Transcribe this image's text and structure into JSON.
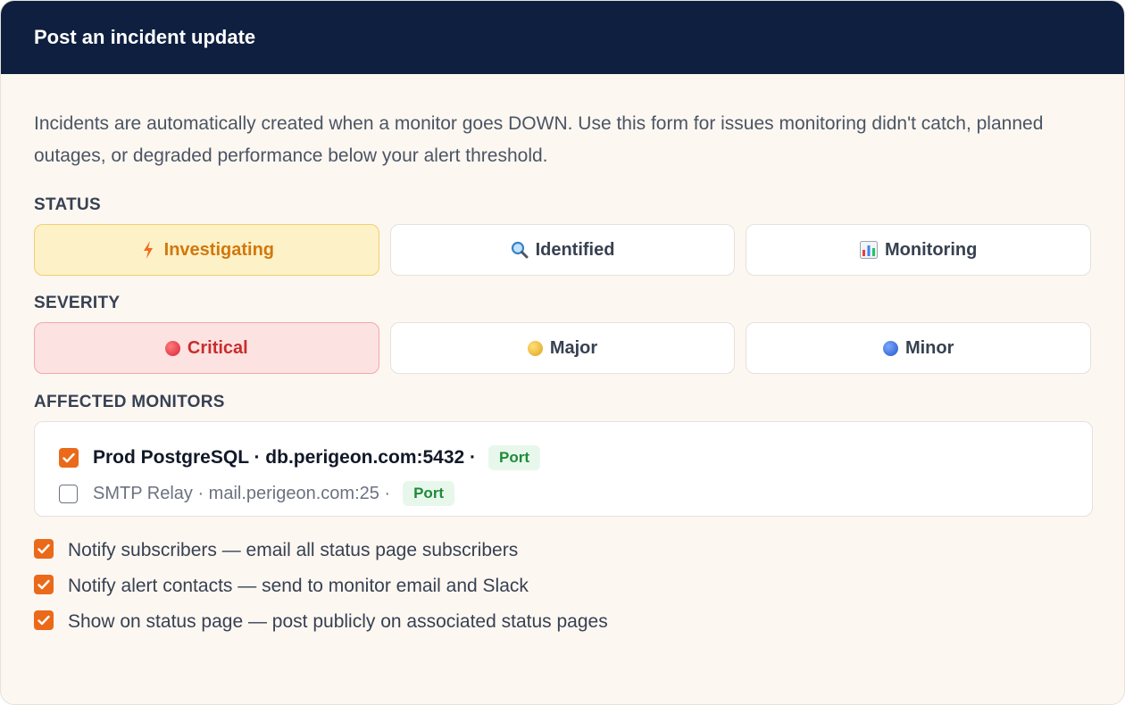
{
  "header": {
    "title": "Post an incident update"
  },
  "intro": "Incidents are automatically created when a monitor goes DOWN. Use this form for issues monitoring didn't catch, planned outages, or degraded performance below your alert threshold.",
  "status": {
    "label": "STATUS",
    "options": [
      {
        "label": "Investigating",
        "icon": "lightning-icon",
        "selected": true
      },
      {
        "label": "Identified",
        "icon": "magnifier-icon",
        "selected": false
      },
      {
        "label": "Monitoring",
        "icon": "bar-chart-icon",
        "selected": false
      }
    ]
  },
  "severity": {
    "label": "SEVERITY",
    "options": [
      {
        "label": "Critical",
        "icon": "red-circle-icon",
        "selected": true
      },
      {
        "label": "Major",
        "icon": "yellow-circle-icon",
        "selected": false
      },
      {
        "label": "Minor",
        "icon": "blue-circle-icon",
        "selected": false
      }
    ]
  },
  "monitors": {
    "label": "AFFECTED MONITORS",
    "items": [
      {
        "text": "Prod PostgreSQL · db.perigeon.com:5432 ·",
        "tag": "Port",
        "checked": true
      },
      {
        "text": "SMTP Relay · mail.perigeon.com:25 ·",
        "tag": "Port",
        "checked": false
      }
    ]
  },
  "notify": [
    {
      "text": "Notify subscribers — email all status page subscribers",
      "checked": true
    },
    {
      "text": "Notify alert contacts — send to monitor email and Slack",
      "checked": true
    },
    {
      "text": "Show on status page — post publicly on associated status pages",
      "checked": true
    }
  ],
  "colors": {
    "header_bg": "#0e1f3f",
    "accent_orange": "#ea6a1a",
    "investigating_text": "#d1780c",
    "critical_text": "#c82d2d",
    "tag_green": "#1f8a3a"
  }
}
